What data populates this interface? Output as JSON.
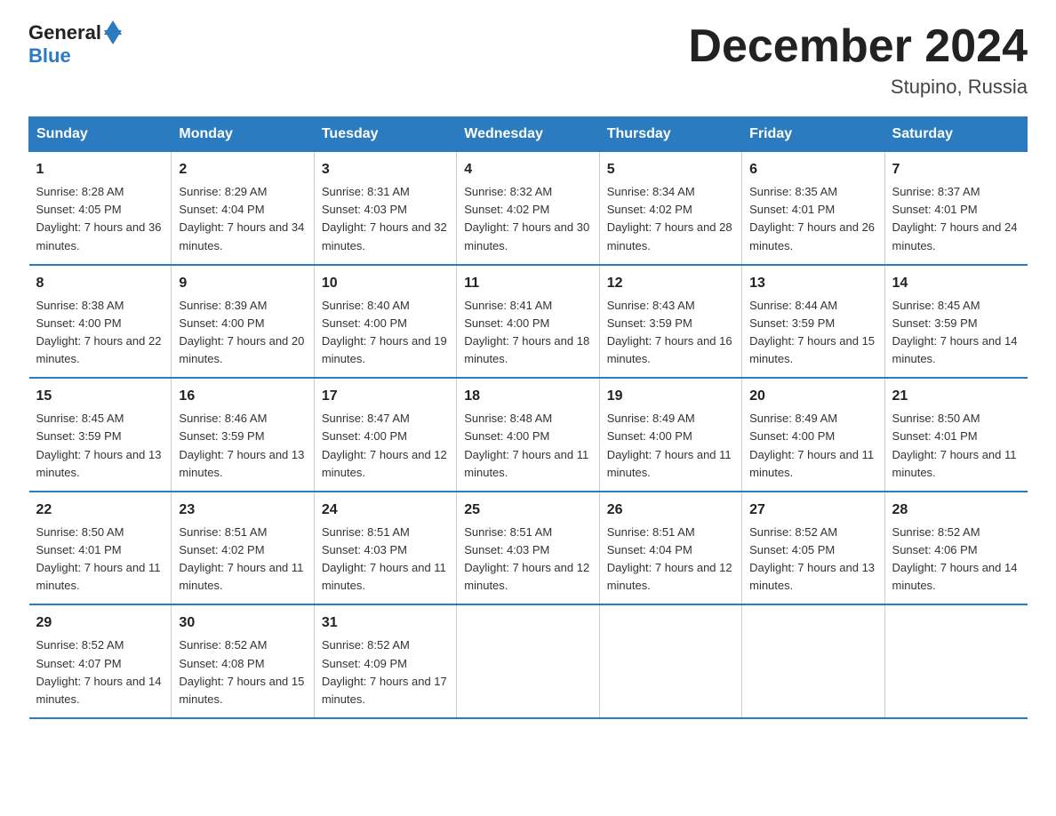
{
  "header": {
    "logo_general": "General",
    "logo_blue": "Blue",
    "month_title": "December 2024",
    "location": "Stupino, Russia"
  },
  "weekdays": [
    "Sunday",
    "Monday",
    "Tuesday",
    "Wednesday",
    "Thursday",
    "Friday",
    "Saturday"
  ],
  "weeks": [
    [
      {
        "day": "1",
        "sunrise": "8:28 AM",
        "sunset": "4:05 PM",
        "daylight": "7 hours and 36 minutes."
      },
      {
        "day": "2",
        "sunrise": "8:29 AM",
        "sunset": "4:04 PM",
        "daylight": "7 hours and 34 minutes."
      },
      {
        "day": "3",
        "sunrise": "8:31 AM",
        "sunset": "4:03 PM",
        "daylight": "7 hours and 32 minutes."
      },
      {
        "day": "4",
        "sunrise": "8:32 AM",
        "sunset": "4:02 PM",
        "daylight": "7 hours and 30 minutes."
      },
      {
        "day": "5",
        "sunrise": "8:34 AM",
        "sunset": "4:02 PM",
        "daylight": "7 hours and 28 minutes."
      },
      {
        "day": "6",
        "sunrise": "8:35 AM",
        "sunset": "4:01 PM",
        "daylight": "7 hours and 26 minutes."
      },
      {
        "day": "7",
        "sunrise": "8:37 AM",
        "sunset": "4:01 PM",
        "daylight": "7 hours and 24 minutes."
      }
    ],
    [
      {
        "day": "8",
        "sunrise": "8:38 AM",
        "sunset": "4:00 PM",
        "daylight": "7 hours and 22 minutes."
      },
      {
        "day": "9",
        "sunrise": "8:39 AM",
        "sunset": "4:00 PM",
        "daylight": "7 hours and 20 minutes."
      },
      {
        "day": "10",
        "sunrise": "8:40 AM",
        "sunset": "4:00 PM",
        "daylight": "7 hours and 19 minutes."
      },
      {
        "day": "11",
        "sunrise": "8:41 AM",
        "sunset": "4:00 PM",
        "daylight": "7 hours and 18 minutes."
      },
      {
        "day": "12",
        "sunrise": "8:43 AM",
        "sunset": "3:59 PM",
        "daylight": "7 hours and 16 minutes."
      },
      {
        "day": "13",
        "sunrise": "8:44 AM",
        "sunset": "3:59 PM",
        "daylight": "7 hours and 15 minutes."
      },
      {
        "day": "14",
        "sunrise": "8:45 AM",
        "sunset": "3:59 PM",
        "daylight": "7 hours and 14 minutes."
      }
    ],
    [
      {
        "day": "15",
        "sunrise": "8:45 AM",
        "sunset": "3:59 PM",
        "daylight": "7 hours and 13 minutes."
      },
      {
        "day": "16",
        "sunrise": "8:46 AM",
        "sunset": "3:59 PM",
        "daylight": "7 hours and 13 minutes."
      },
      {
        "day": "17",
        "sunrise": "8:47 AM",
        "sunset": "4:00 PM",
        "daylight": "7 hours and 12 minutes."
      },
      {
        "day": "18",
        "sunrise": "8:48 AM",
        "sunset": "4:00 PM",
        "daylight": "7 hours and 11 minutes."
      },
      {
        "day": "19",
        "sunrise": "8:49 AM",
        "sunset": "4:00 PM",
        "daylight": "7 hours and 11 minutes."
      },
      {
        "day": "20",
        "sunrise": "8:49 AM",
        "sunset": "4:00 PM",
        "daylight": "7 hours and 11 minutes."
      },
      {
        "day": "21",
        "sunrise": "8:50 AM",
        "sunset": "4:01 PM",
        "daylight": "7 hours and 11 minutes."
      }
    ],
    [
      {
        "day": "22",
        "sunrise": "8:50 AM",
        "sunset": "4:01 PM",
        "daylight": "7 hours and 11 minutes."
      },
      {
        "day": "23",
        "sunrise": "8:51 AM",
        "sunset": "4:02 PM",
        "daylight": "7 hours and 11 minutes."
      },
      {
        "day": "24",
        "sunrise": "8:51 AM",
        "sunset": "4:03 PM",
        "daylight": "7 hours and 11 minutes."
      },
      {
        "day": "25",
        "sunrise": "8:51 AM",
        "sunset": "4:03 PM",
        "daylight": "7 hours and 12 minutes."
      },
      {
        "day": "26",
        "sunrise": "8:51 AM",
        "sunset": "4:04 PM",
        "daylight": "7 hours and 12 minutes."
      },
      {
        "day": "27",
        "sunrise": "8:52 AM",
        "sunset": "4:05 PM",
        "daylight": "7 hours and 13 minutes."
      },
      {
        "day": "28",
        "sunrise": "8:52 AM",
        "sunset": "4:06 PM",
        "daylight": "7 hours and 14 minutes."
      }
    ],
    [
      {
        "day": "29",
        "sunrise": "8:52 AM",
        "sunset": "4:07 PM",
        "daylight": "7 hours and 14 minutes."
      },
      {
        "day": "30",
        "sunrise": "8:52 AM",
        "sunset": "4:08 PM",
        "daylight": "7 hours and 15 minutes."
      },
      {
        "day": "31",
        "sunrise": "8:52 AM",
        "sunset": "4:09 PM",
        "daylight": "7 hours and 17 minutes."
      },
      null,
      null,
      null,
      null
    ]
  ]
}
